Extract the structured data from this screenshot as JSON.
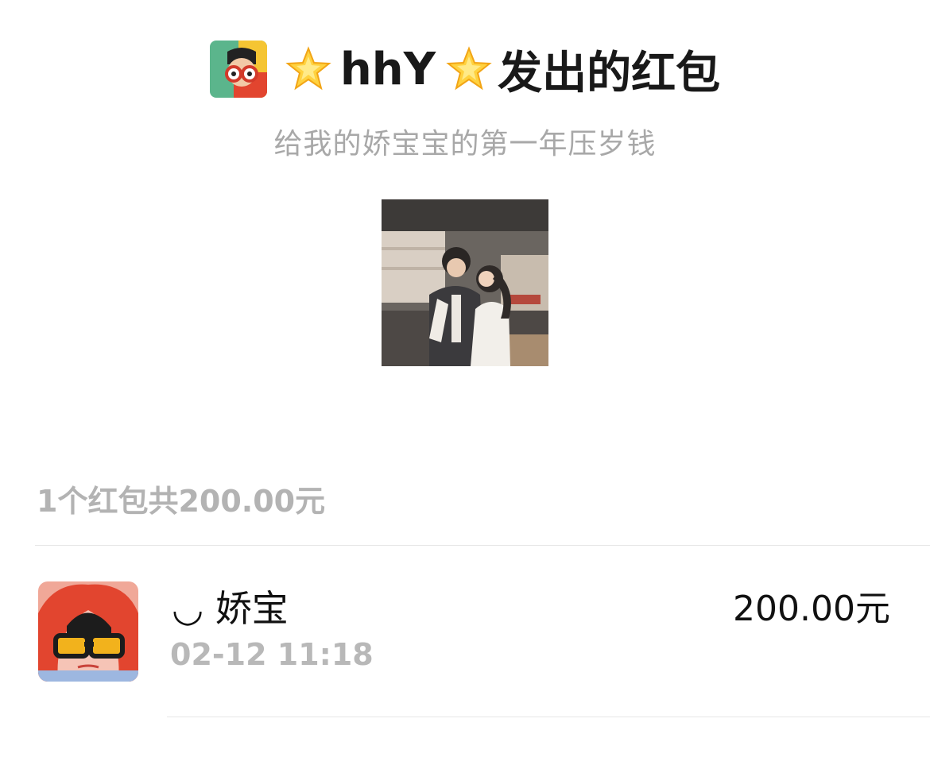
{
  "header": {
    "sender_name": "hhY",
    "title_suffix": "发出的红包",
    "star_emoji": "star-icon"
  },
  "blessing": "给我的娇宝宝的第一年压岁钱",
  "summary": "1个红包共200.00元",
  "records": [
    {
      "name": "◡ 娇宝",
      "time": "02-12 11:18",
      "amount": "200.00元"
    }
  ],
  "colors": {
    "title": "#191919",
    "muted": "#a8a8a8",
    "divider": "#e6e6e6",
    "avatar_green": "#5bb58c",
    "avatar_red": "#e2452f"
  }
}
